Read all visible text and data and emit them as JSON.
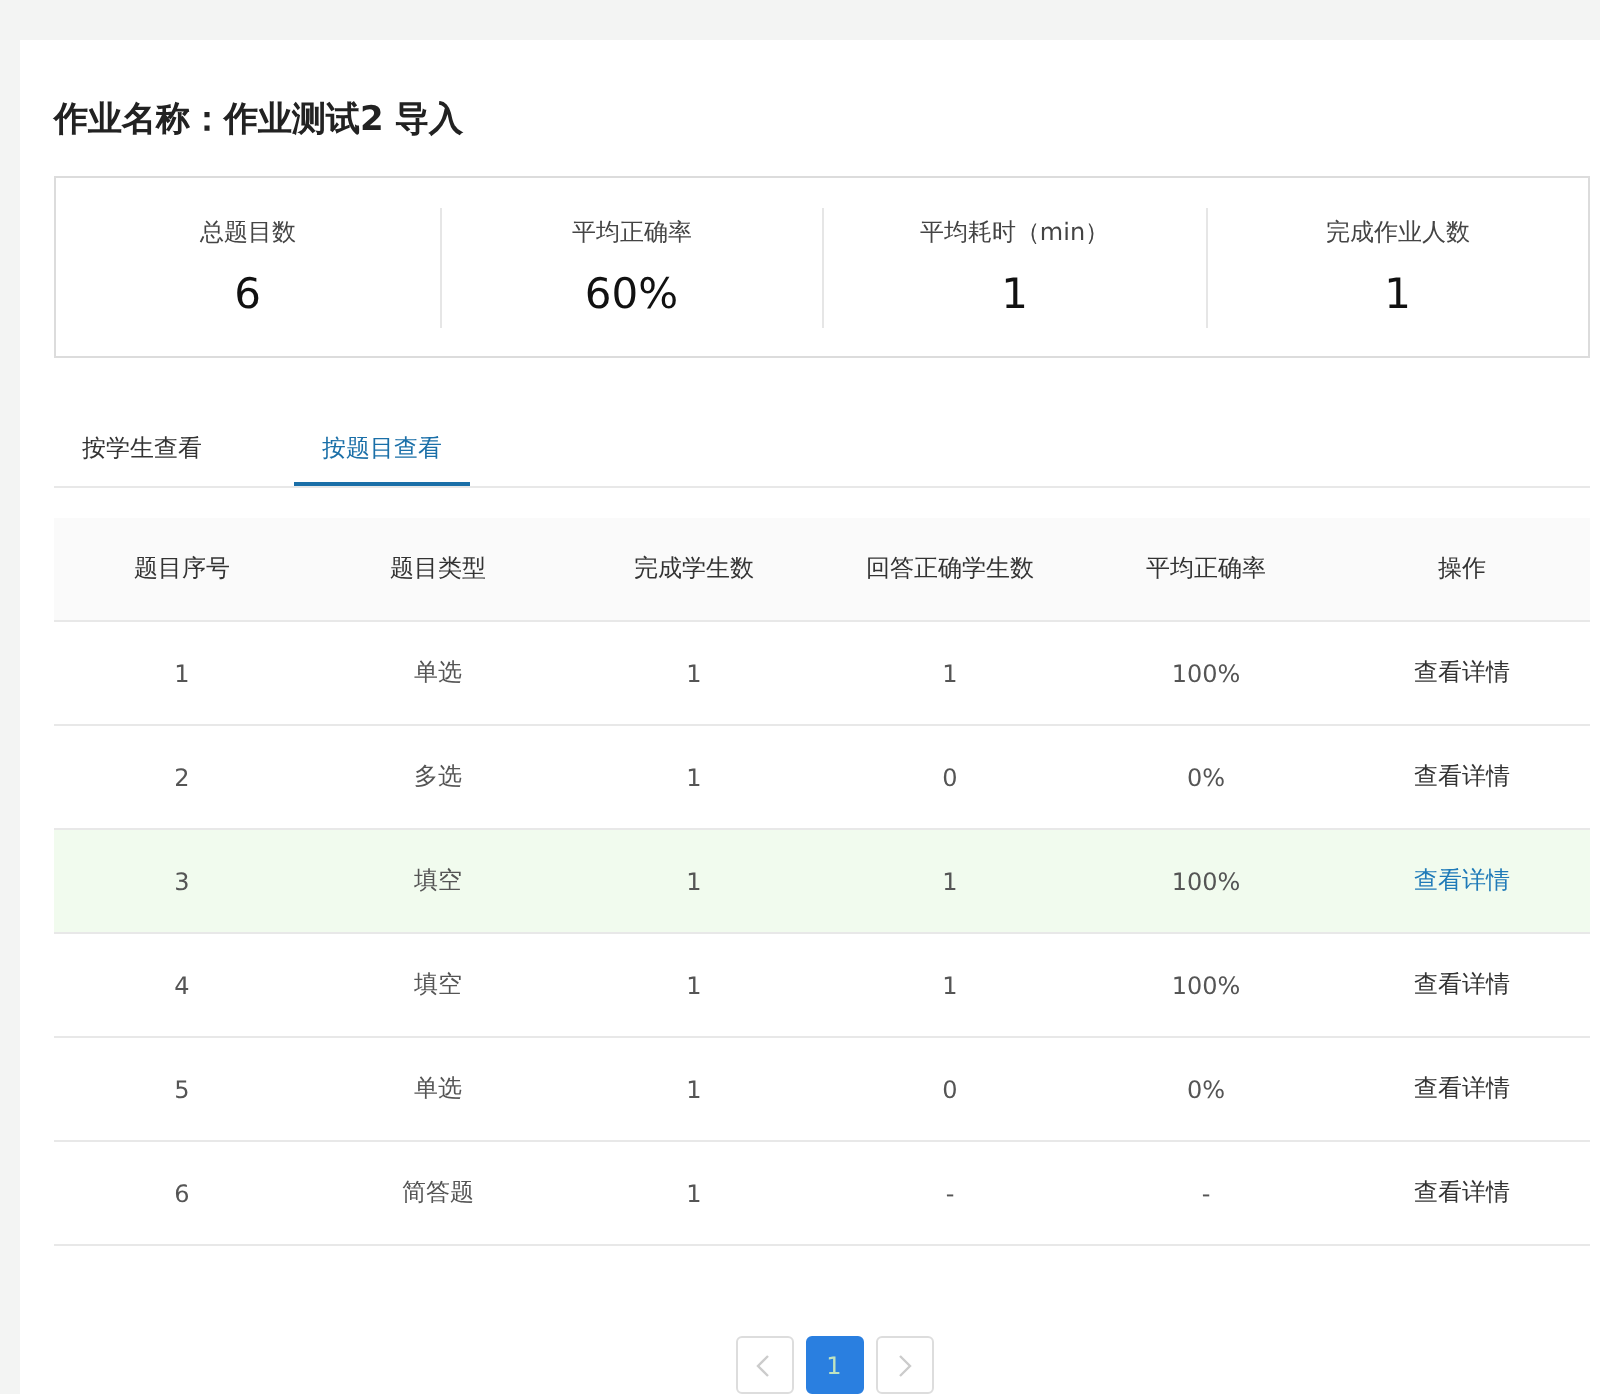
{
  "title": "作业名称：作业测试2 导入",
  "stats": [
    {
      "label": "总题目数",
      "value": "6"
    },
    {
      "label": "平均正确率",
      "value": "60%"
    },
    {
      "label": "平均耗时（min）",
      "value": "1"
    },
    {
      "label": "完成作业人数",
      "value": "1"
    }
  ],
  "tabs": [
    {
      "label": "按学生查看",
      "selected": false
    },
    {
      "label": "按题目查看",
      "selected": true
    }
  ],
  "table": {
    "columns": [
      "题目序号",
      "题目类型",
      "完成学生数",
      "回答正确学生数",
      "平均正确率",
      "操作"
    ],
    "rows": [
      {
        "cells": [
          "1",
          "单选",
          "1",
          "1",
          "100%"
        ],
        "action": "查看详情",
        "highlighted": false
      },
      {
        "cells": [
          "2",
          "多选",
          "1",
          "0",
          "0%"
        ],
        "action": "查看详情",
        "highlighted": false
      },
      {
        "cells": [
          "3",
          "填空",
          "1",
          "1",
          "100%"
        ],
        "action": "查看详情",
        "highlighted": true
      },
      {
        "cells": [
          "4",
          "填空",
          "1",
          "1",
          "100%"
        ],
        "action": "查看详情",
        "highlighted": false
      },
      {
        "cells": [
          "5",
          "单选",
          "1",
          "0",
          "0%"
        ],
        "action": "查看详情",
        "highlighted": false
      },
      {
        "cells": [
          "6",
          "简答题",
          "1",
          "-",
          "-"
        ],
        "action": "查看详情",
        "highlighted": false
      }
    ]
  },
  "pagination": {
    "pages": [
      {
        "label": "1",
        "selected": true
      }
    ],
    "prev_disabled": true,
    "next_disabled": true
  }
}
